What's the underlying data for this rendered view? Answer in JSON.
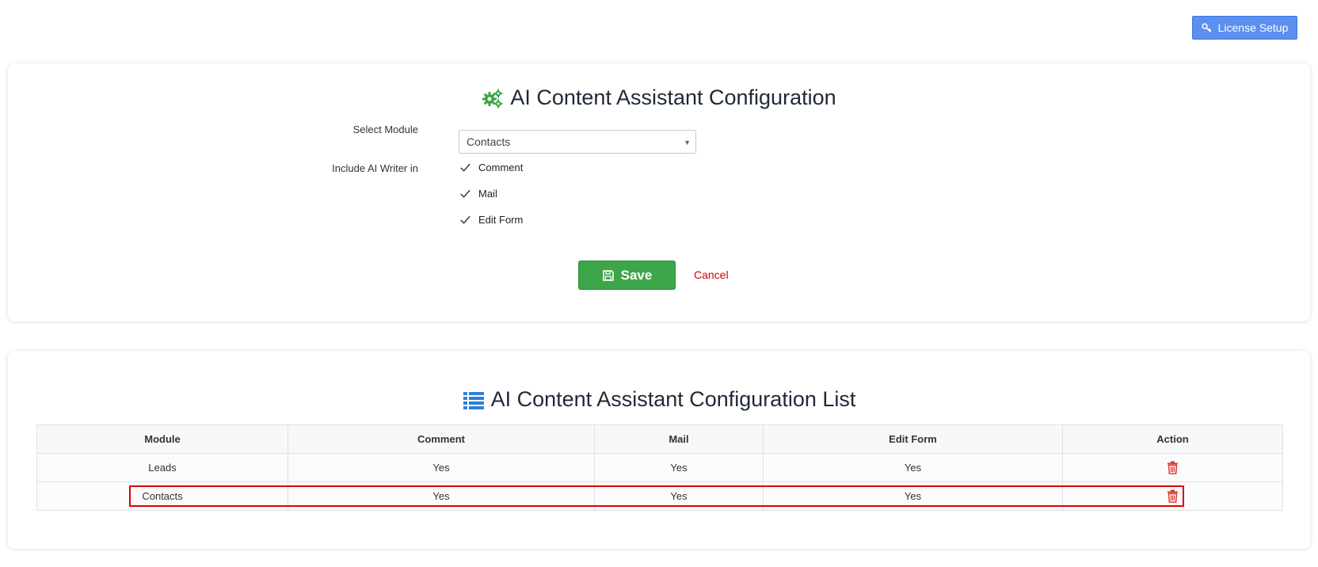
{
  "header": {
    "license_button_label": "License Setup",
    "license_icon": "key-icon"
  },
  "config_form": {
    "title": "AI Content Assistant Configuration",
    "title_icon": "gears-icon",
    "select_module_label": "Select Module",
    "select_module_value": "Contacts",
    "include_label": "Include AI Writer in",
    "options": [
      {
        "label": "Comment",
        "checked": true
      },
      {
        "label": "Mail",
        "checked": true
      },
      {
        "label": "Edit Form",
        "checked": true
      }
    ],
    "save_label": "Save",
    "cancel_label": "Cancel"
  },
  "config_list": {
    "title": "AI Content Assistant Configuration List",
    "title_icon": "list-icon",
    "columns": [
      "Module",
      "Comment",
      "Mail",
      "Edit Form",
      "Action"
    ],
    "rows": [
      {
        "module": "Leads",
        "comment": "Yes",
        "mail": "Yes",
        "edit_form": "Yes",
        "action_icon": "trash-icon"
      },
      {
        "module": "Contacts",
        "comment": "Yes",
        "mail": "Yes",
        "edit_form": "Yes",
        "action_icon": "trash-icon"
      }
    ]
  },
  "colors": {
    "primary_button": "#5b8ff0",
    "save_button": "#3da54a",
    "cancel_text": "#d10000",
    "delete_icon": "#e03b2e",
    "gear_icon": "#3da54a",
    "list_icon": "#2f80d8",
    "highlight_border": "#e00000"
  }
}
